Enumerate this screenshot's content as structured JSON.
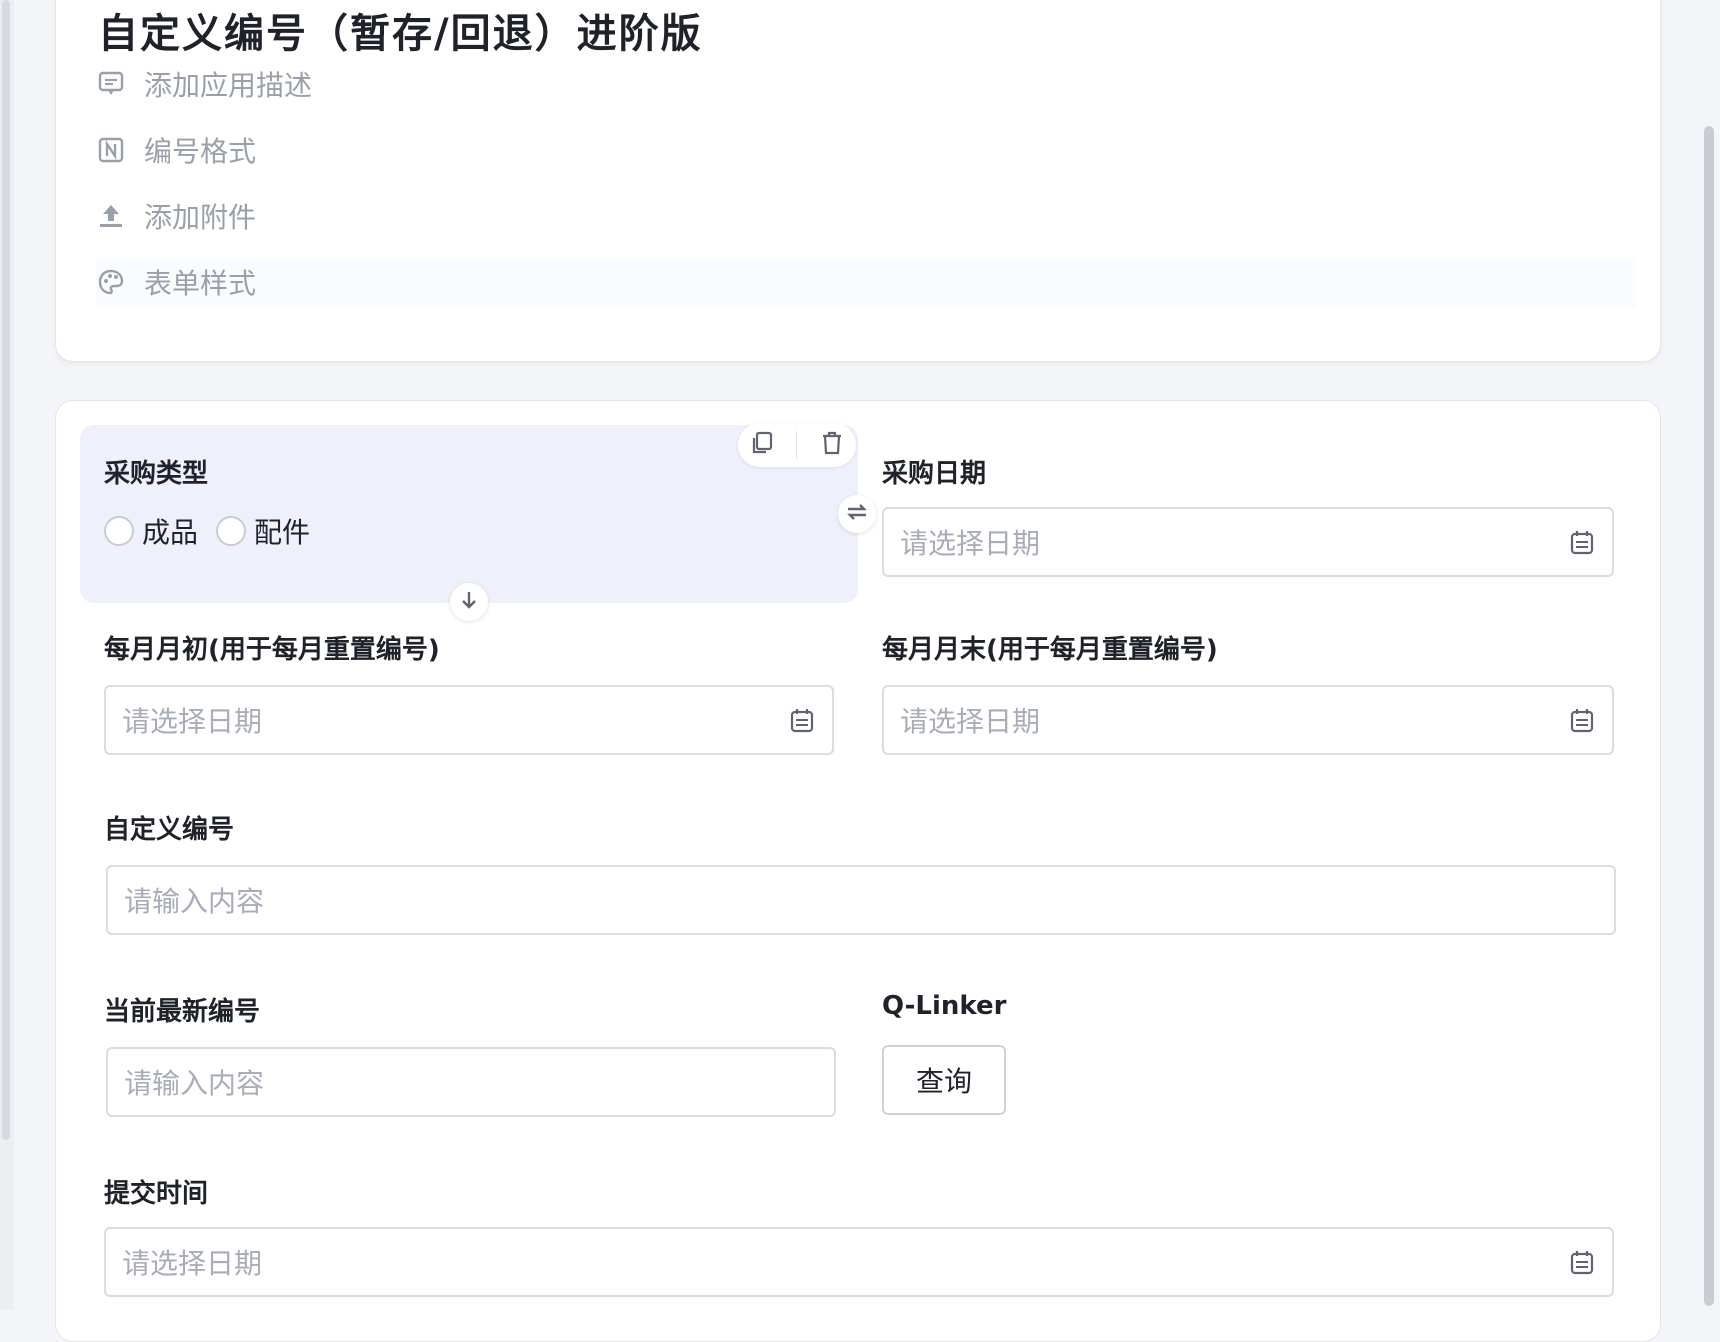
{
  "app": {
    "title": "自定义编号（暂存/回退）进阶版",
    "meta": [
      {
        "label": "添加应用描述",
        "icon": "comment-icon"
      },
      {
        "label": "编号格式",
        "icon": "number-format-icon"
      },
      {
        "label": "添加附件",
        "icon": "upload-icon"
      },
      {
        "label": "表单样式",
        "icon": "palette-icon"
      }
    ]
  },
  "form": {
    "purchase_type": {
      "label": "采购类型",
      "options": [
        "成品",
        "配件"
      ]
    },
    "purchase_date": {
      "label": "采购日期",
      "placeholder": "请选择日期"
    },
    "month_start": {
      "label": "每月月初(用于每月重置编号)",
      "placeholder": "请选择日期"
    },
    "month_end": {
      "label": "每月月末(用于每月重置编号)",
      "placeholder": "请选择日期"
    },
    "custom_number": {
      "label": "自定义编号",
      "placeholder": "请输入内容"
    },
    "latest_number": {
      "label": "当前最新编号",
      "placeholder": "请输入内容"
    },
    "qlinker": {
      "label": "Q-Linker",
      "button": "查询"
    },
    "submit_time": {
      "label": "提交时间",
      "placeholder": "请选择日期"
    }
  },
  "colors": {
    "selected_bg": "#eef0fb",
    "muted_text": "#9aa0aa",
    "border": "#d9dce2"
  }
}
